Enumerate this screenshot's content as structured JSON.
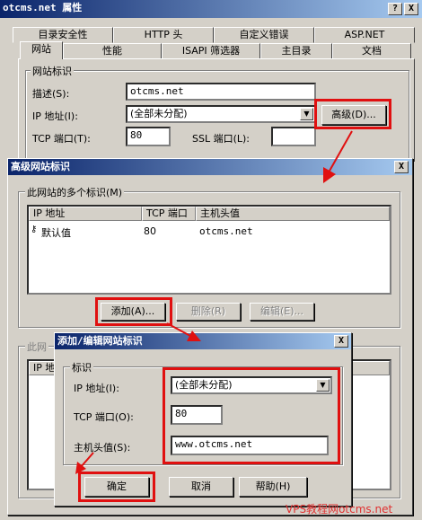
{
  "main_window": {
    "title": "otcms.net 属性",
    "help_btn": "?",
    "close_btn": "X",
    "tabs_row1": [
      "目录安全性",
      "HTTP 头",
      "自定义错误",
      "ASP.NET"
    ],
    "tabs_row2": [
      "网站",
      "性能",
      "ISAPI 筛选器",
      "主目录",
      "文档"
    ],
    "group_label": "网站标识",
    "desc_label": "描述(S):",
    "desc_value": "otcms.net",
    "ip_label": "IP 地址(I):",
    "ip_value": "(全部未分配)",
    "tcp_label": "TCP 端口(T):",
    "tcp_value": "80",
    "ssl_label": "SSL 端口(L):",
    "ssl_value": "",
    "advanced_btn": "高级(D)..."
  },
  "adv_dialog": {
    "title": "高级网站标识",
    "close_btn": "X",
    "group1_label": "此网站的多个标识(M)",
    "columns": [
      "IP 地址",
      "TCP 端口",
      "主机头值"
    ],
    "rows": [
      {
        "ip": "默认值",
        "port": "80",
        "host": "otcms.net"
      }
    ],
    "add_btn": "添加(A)...",
    "remove_btn": "删除(R)",
    "edit_btn": "编辑(E)...",
    "group2_label": "此网",
    "col2_partial": "IP 地"
  },
  "edit_dialog": {
    "title": "添加/编辑网站标识",
    "close_btn": "X",
    "group_label": "标识",
    "ip_label": "IP 地址(I):",
    "ip_value": "(全部未分配)",
    "tcp_label": "TCP 端口(O):",
    "tcp_value": "80",
    "host_label": "主机头值(S):",
    "host_value": "www.otcms.net",
    "ok_btn": "确定",
    "cancel_btn": "取消",
    "help_btn": "帮助(H)"
  },
  "watermark": "VPS教程网otcms.net",
  "colors": {
    "highlight": "#e01010",
    "titlebar": "#0a246a",
    "watermark": "#e03030"
  }
}
